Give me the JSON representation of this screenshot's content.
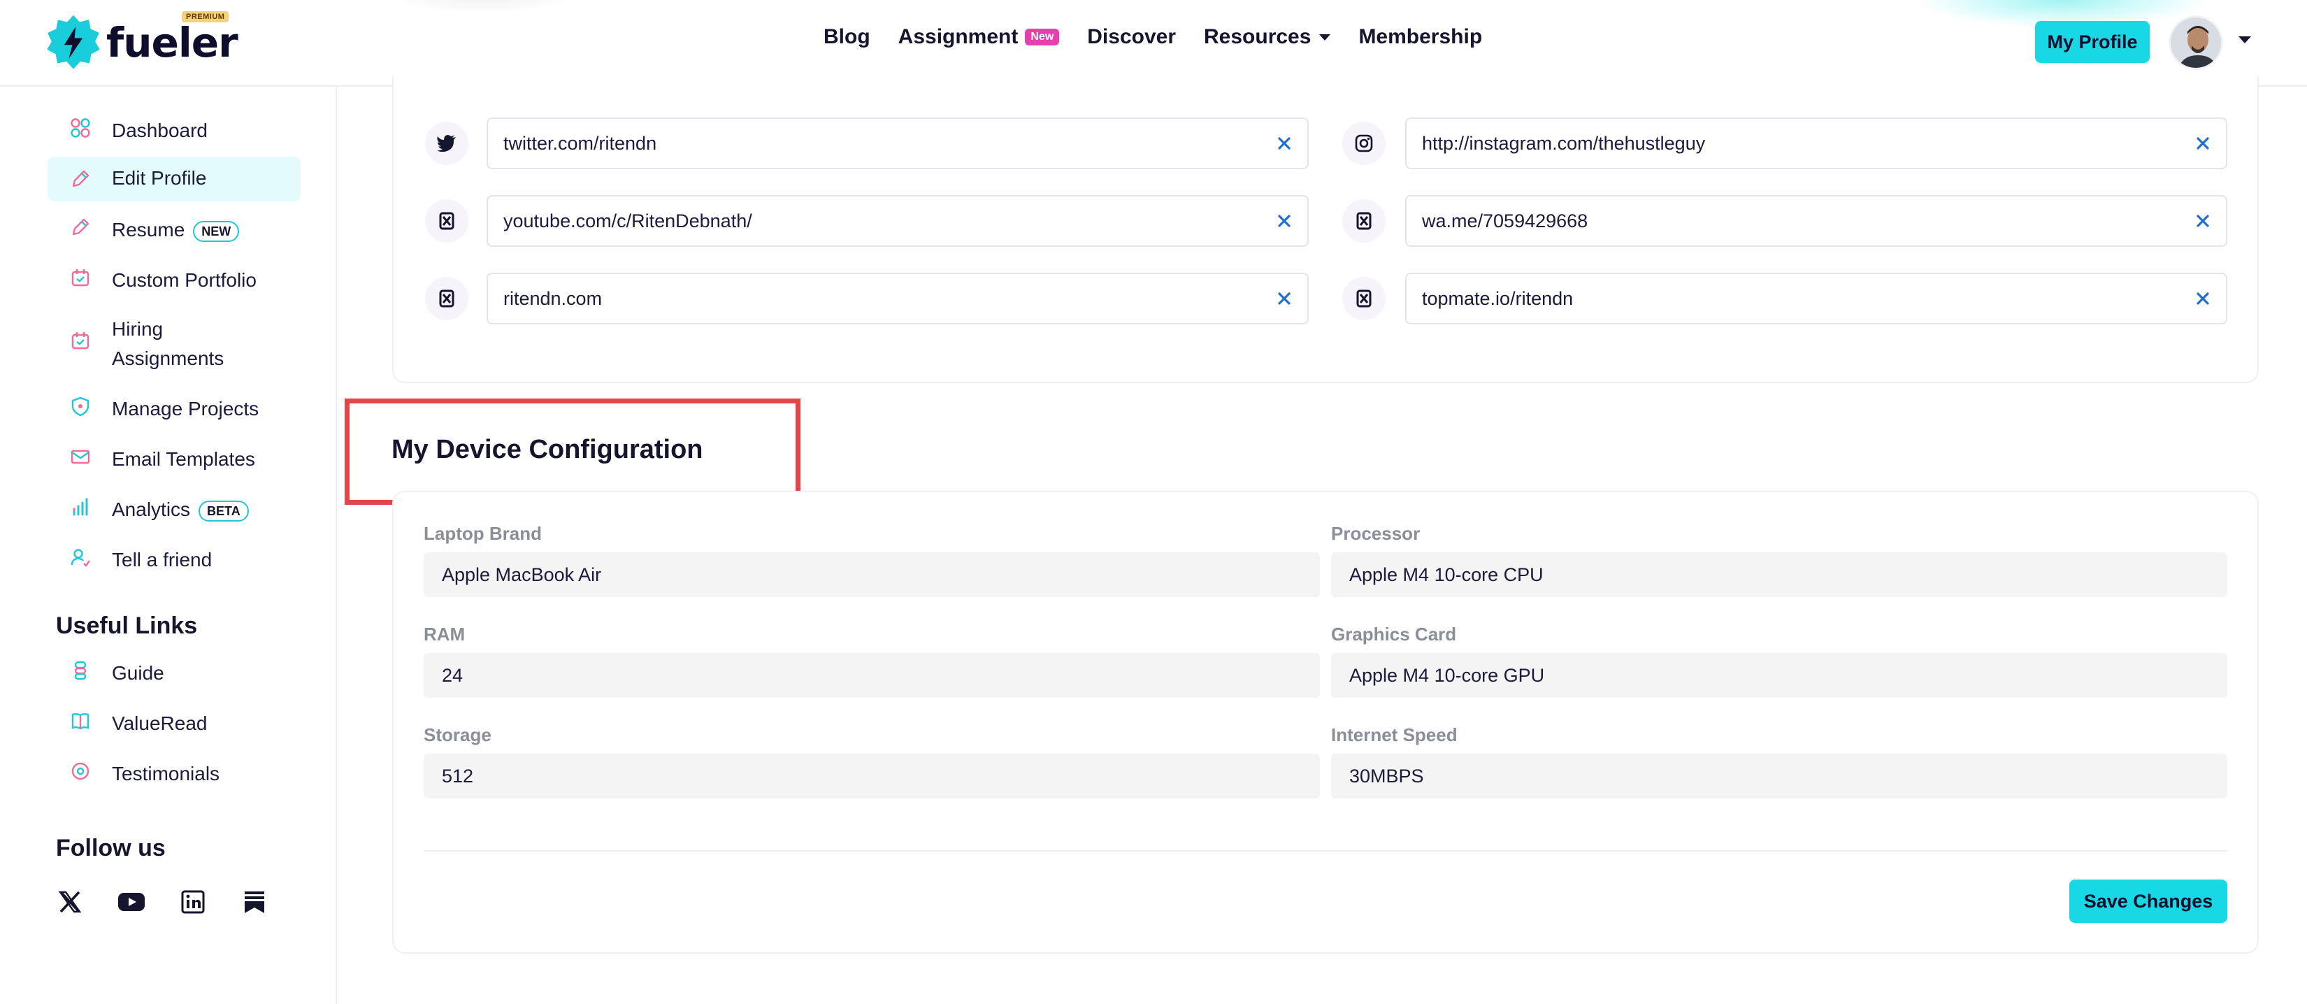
{
  "header": {
    "logo_text": "fueler",
    "premium_badge": "PREMIUM",
    "nav": [
      {
        "label": "Blog"
      },
      {
        "label": "Assignment",
        "badge": "New"
      },
      {
        "label": "Discover"
      },
      {
        "label": "Resources"
      },
      {
        "label": "Membership"
      }
    ],
    "profile_button": "My Profile"
  },
  "sidebar": {
    "items": [
      {
        "label": "Dashboard",
        "icon": "grid-icon"
      },
      {
        "label": "Edit Profile",
        "icon": "pencil-icon",
        "active": true
      },
      {
        "label": "Resume",
        "icon": "pencil-icon",
        "badge": "NEW"
      },
      {
        "label": "Custom Portfolio",
        "icon": "calendar-icon"
      },
      {
        "label": "Hiring Assignments",
        "icon": "calendar-icon"
      },
      {
        "label": "Manage Projects",
        "icon": "shield-icon"
      },
      {
        "label": "Email Templates",
        "icon": "mail-icon"
      },
      {
        "label": "Analytics",
        "icon": "bar-chart-icon",
        "badge": "BETA"
      },
      {
        "label": "Tell a friend",
        "icon": "user-plus-icon"
      }
    ],
    "useful_links_title": "Useful Links",
    "useful_links": [
      {
        "label": "Guide",
        "icon": "guide-icon"
      },
      {
        "label": "ValueRead",
        "icon": "book-icon"
      },
      {
        "label": "Testimonials",
        "icon": "chat-icon"
      }
    ],
    "follow_title": "Follow us",
    "follow_icons": [
      "x-icon",
      "youtube-icon",
      "linkedin-icon",
      "substack-icon"
    ]
  },
  "social_links": [
    {
      "icon": "twitter-icon",
      "value": "twitter.com/ritendn"
    },
    {
      "icon": "instagram-icon",
      "value": "http://instagram.com/thehustleguy"
    },
    {
      "icon": "link-icon",
      "value": "youtube.com/c/RitenDebnath/"
    },
    {
      "icon": "link-icon",
      "value": "wa.me/7059429668"
    },
    {
      "icon": "link-icon",
      "value": "ritendn.com"
    },
    {
      "icon": "link-icon",
      "value": "topmate.io/ritendn"
    }
  ],
  "device_config": {
    "title": "My Device Configuration",
    "fields": [
      {
        "label": "Laptop Brand",
        "value": "Apple MacBook Air"
      },
      {
        "label": "Processor",
        "value": "Apple M4 10-core CPU"
      },
      {
        "label": "RAM",
        "value": "24"
      },
      {
        "label": "Graphics Card",
        "value": "Apple M4 10-core GPU"
      },
      {
        "label": "Storage",
        "value": "512"
      },
      {
        "label": "Internet Speed",
        "value": "30MBPS"
      }
    ],
    "save_label": "Save Changes"
  },
  "colors": {
    "accent": "#19d8e5",
    "highlight": "#e04848",
    "new_badge": "#e83fb0"
  }
}
